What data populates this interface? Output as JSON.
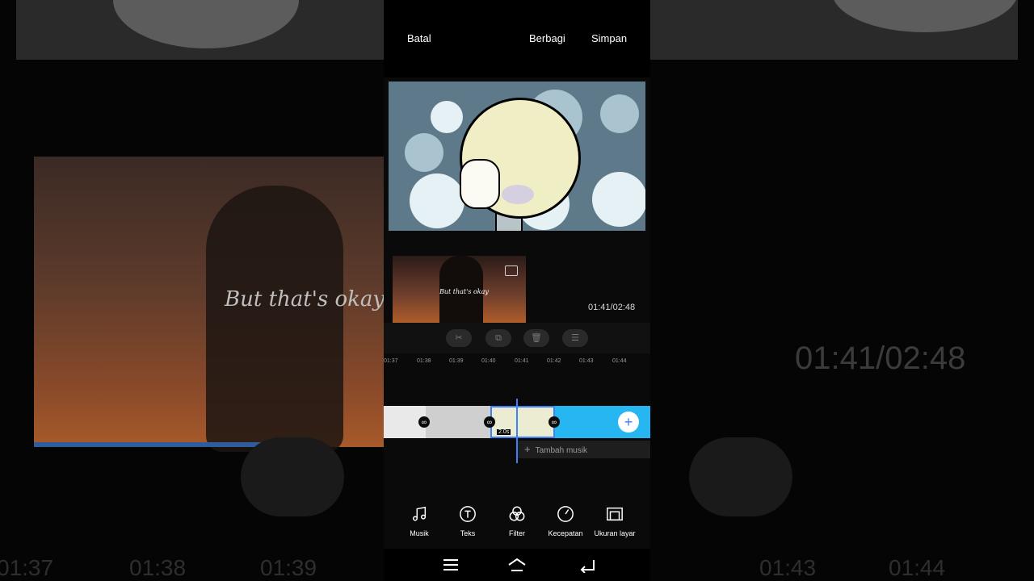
{
  "topbar": {
    "cancel_label": "Batal",
    "share_label": "Berbagi",
    "save_label": "Simpan"
  },
  "preview": {
    "clip_caption": "But that's okay",
    "time": "01:41/02:48",
    "playback_progress": 0.45
  },
  "edit_tools": [
    {
      "icon": "scissors-icon"
    },
    {
      "icon": "duplicate-icon"
    },
    {
      "icon": "trash-icon"
    },
    {
      "icon": "sort-icon"
    }
  ],
  "timeline": {
    "ruler": [
      "01:37",
      "01:38",
      "01:39",
      "01:40",
      "01:41",
      "01:42",
      "01:43",
      "01:44"
    ],
    "selected_clip_duration": "2.0s",
    "add_music_label": "Tambah musik",
    "accent_color": "#3b82f6"
  },
  "bottom_tools": [
    {
      "label": "Musik",
      "icon": "music-note-icon"
    },
    {
      "label": "Teks",
      "icon": "text-icon"
    },
    {
      "label": "Filter",
      "icon": "filter-icon"
    },
    {
      "label": "Kecepatan",
      "icon": "speed-icon"
    },
    {
      "label": "Ukuran layar",
      "icon": "screen-size-icon"
    }
  ],
  "nav": {
    "menu": "menu-icon",
    "home": "home-icon",
    "back": "back-icon"
  }
}
